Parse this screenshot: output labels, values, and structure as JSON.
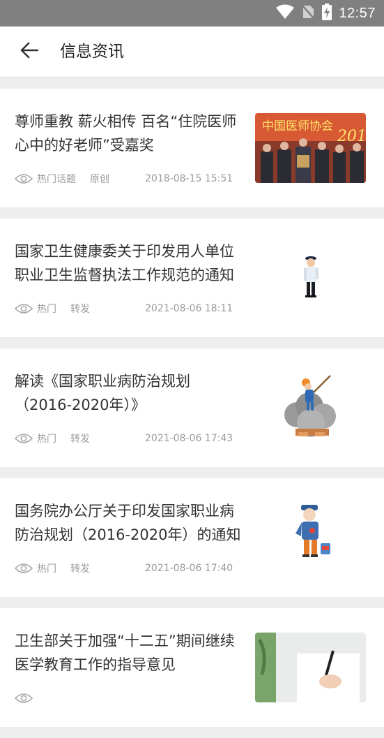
{
  "status_bar": {
    "time": "12:57"
  },
  "app_bar": {
    "title": "信息资讯"
  },
  "articles": [
    {
      "title": "尊师重教 薪火相传 百名“住院医师心中的好老师”受嘉奖",
      "tag": "热门话题",
      "source": "原创",
      "date": "2018-08-15 15:51",
      "thumb_icon": "ceremony-photo",
      "thumb_caption": "中国医师协会"
    },
    {
      "title": "国家卫生健康委关于印发用人单位职业卫生监督执法工作规范的通知",
      "tag": "热门",
      "source": "转发",
      "date": "2021-08-06 18:11",
      "thumb_icon": "inspector-illustration"
    },
    {
      "title": "解读《国家职业病防治规划（2016-2020年）》",
      "tag": "热门",
      "source": "转发",
      "date": "2021-08-06 17:43",
      "thumb_icon": "dusty-worker-illustration"
    },
    {
      "title": "国务院办公厅关于印发国家职业病防治规划（2016-2020年）的通知",
      "tag": "热门",
      "source": "转发",
      "date": "2021-08-06 17:40",
      "thumb_icon": "coughing-worker-illustration"
    },
    {
      "title": "卫生部关于加强“十二五”期间继续医学教育工作的指导意见",
      "tag": "",
      "source": "",
      "date": "",
      "thumb_icon": "writing-hand-photo"
    }
  ]
}
